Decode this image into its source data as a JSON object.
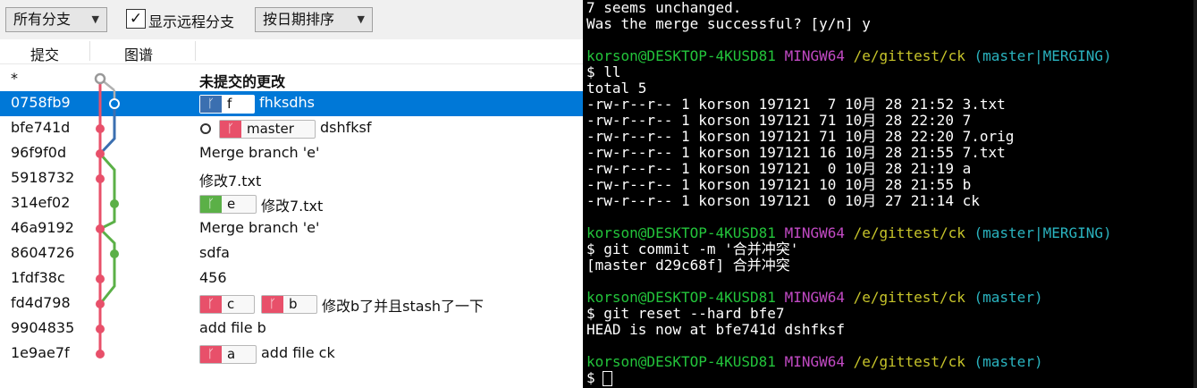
{
  "toolbar": {
    "branch_filter": "所有分支",
    "show_remote_label": "显示远程分支",
    "show_remote_checked": "✓",
    "sort_order": "按日期排序"
  },
  "columns": {
    "commit": "提交",
    "graph": "图谱"
  },
  "colors": {
    "selection": "#0078d7",
    "branch_tag_red": "#e8506a",
    "branch_tag_green": "#5bb047",
    "branch_tag_blue": "#3b6fb0",
    "terminal_green": "#23c43b",
    "terminal_purple": "#c24ac4",
    "terminal_yellow": "#c7c42a",
    "terminal_cyan": "#2ab3bf"
  },
  "commits": [
    {
      "hash": "*",
      "message": "未提交的更改",
      "tags": []
    },
    {
      "hash": "0758fb9",
      "message": "fhksdhs",
      "tags": [
        "f"
      ]
    },
    {
      "hash": "bfe741d",
      "message": "dshfksf",
      "tags": [
        "master"
      ]
    },
    {
      "hash": "96f9f0d",
      "message": "Merge branch 'e'",
      "tags": []
    },
    {
      "hash": "5918732",
      "message": "修改7.txt",
      "tags": []
    },
    {
      "hash": "314ef02",
      "message": "修改7.txt",
      "tags": [
        "e"
      ]
    },
    {
      "hash": "46a9192",
      "message": "Merge branch 'e'",
      "tags": []
    },
    {
      "hash": "8604726",
      "message": "sdfa",
      "tags": []
    },
    {
      "hash": "1fdf38c",
      "message": "456",
      "tags": []
    },
    {
      "hash": "fd4d798",
      "message": "修改b了并且stash了一下",
      "tags": [
        "c",
        "b"
      ]
    },
    {
      "hash": "9904835",
      "message": "add file b",
      "tags": []
    },
    {
      "hash": "1e9ae7f",
      "message": "add file ck",
      "tags": [
        "a"
      ]
    }
  ],
  "terminal": {
    "prompt_user": "korson@DESKTOP-4KUSD81",
    "prompt_env": "MINGW64",
    "prompt_path": "/e/gittest/ck",
    "prompt_branch_merging": "(master|MERGING)",
    "prompt_branch": "(master)",
    "lines": {
      "l0": "7 seems unchanged.",
      "l1": "Was the merge successful? [y/n] y",
      "l2": "$ ll",
      "l3": "total 5",
      "l4": "-rw-r--r-- 1 korson 197121  7 10月 28 21:52 3.txt",
      "l5": "-rw-r--r-- 1 korson 197121 71 10月 28 22:20 7",
      "l6": "-rw-r--r-- 1 korson 197121 71 10月 28 22:20 7.orig",
      "l7": "-rw-r--r-- 1 korson 197121 16 10月 28 21:55 7.txt",
      "l8": "-rw-r--r-- 1 korson 197121  0 10月 28 21:19 a",
      "l9": "-rw-r--r-- 1 korson 197121 10 10月 28 21:55 b",
      "l10": "-rw-r--r-- 1 korson 197121  0 10月 27 21:14 ck",
      "l11": "$ git commit -m '合并冲突'",
      "l12": "[master d29c68f] 合并冲突",
      "l13": "$ git reset --hard bfe7",
      "l14": "HEAD is now at bfe741d dshfksf",
      "l15": "$"
    }
  }
}
